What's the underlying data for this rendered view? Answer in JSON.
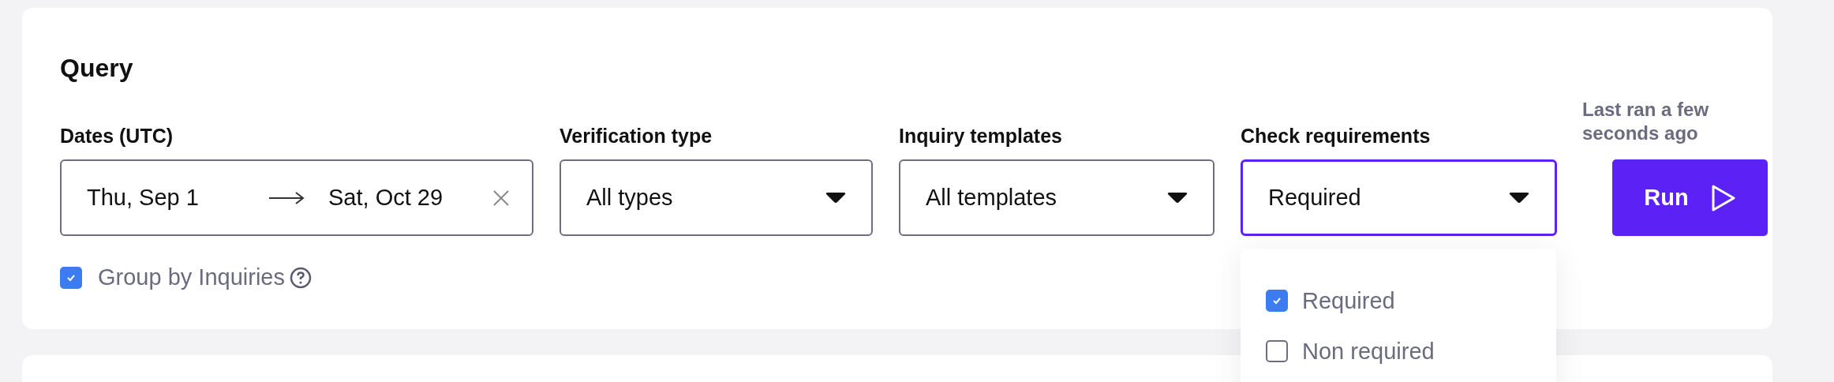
{
  "query": {
    "title": "Query",
    "dates": {
      "label": "Dates (UTC)",
      "start": "Thu, Sep 1",
      "end": "Sat, Oct 29"
    },
    "filters": [
      {
        "label": "Verification type",
        "value": "All types",
        "focused": false
      },
      {
        "label": "Inquiry templates",
        "value": "All templates",
        "focused": false
      },
      {
        "label": "Check requirements",
        "value": "Required",
        "focused": true
      }
    ],
    "last_ran": "Last ran a few seconds ago",
    "run_button": "Run",
    "group_by": {
      "label": "Group by Inquiries",
      "checked": true
    }
  },
  "dropdown": {
    "options": [
      {
        "label": "Required",
        "checked": true
      },
      {
        "label": "Non required",
        "checked": false
      }
    ]
  }
}
